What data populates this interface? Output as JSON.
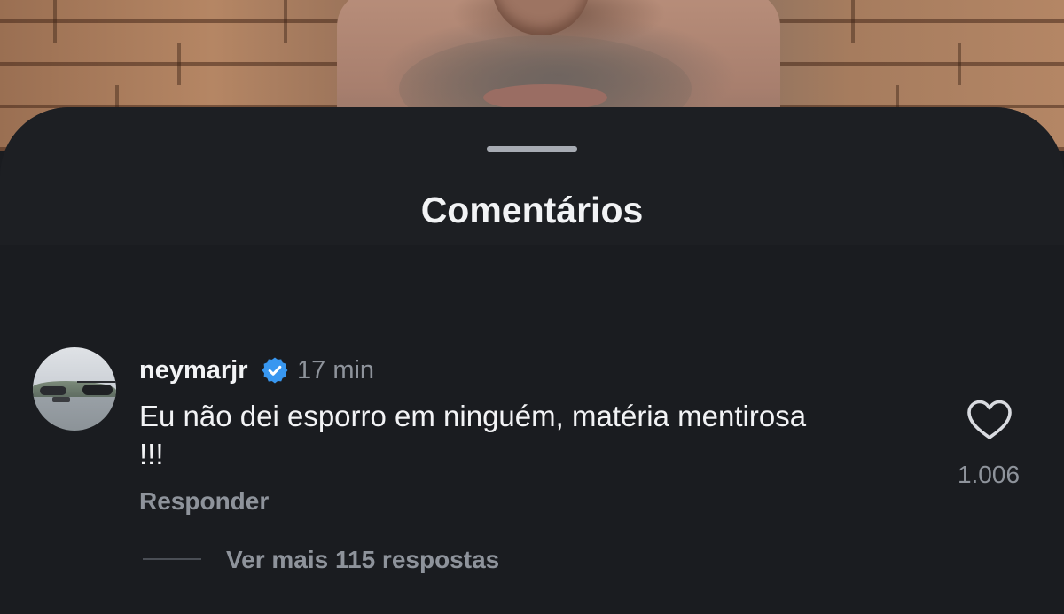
{
  "sheet": {
    "title": "Comentários"
  },
  "comment": {
    "username": "neymarjr",
    "verified": true,
    "timestamp": "17 min",
    "text": "Eu não dei esporro em ninguém, matéria mentirosa !!!",
    "reply_label": "Responder",
    "like_count": "1.006",
    "view_replies_label": "Ver mais 115 respostas"
  },
  "icons": {
    "verified": "verified-badge-icon",
    "like": "heart-icon"
  },
  "colors": {
    "background": "#1a1c20",
    "primary_text": "#f2f3f5",
    "secondary_text": "#8e939b",
    "verified_blue": "#3897f0"
  }
}
